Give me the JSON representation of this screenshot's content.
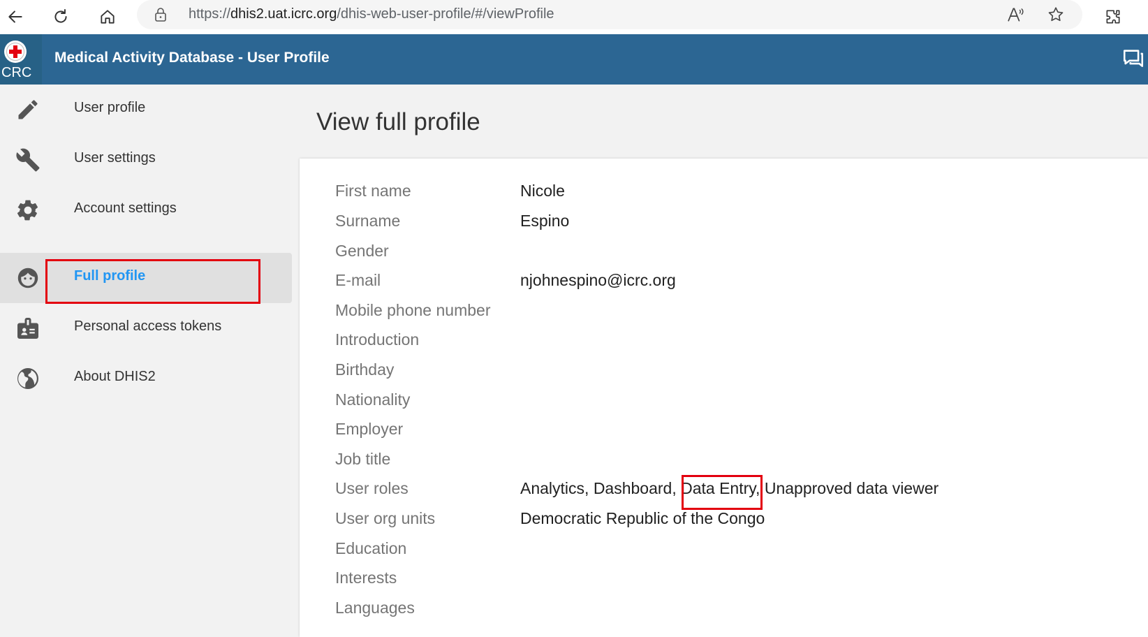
{
  "browser": {
    "url_prefix": "https://",
    "url_host": "dhis2.uat.icrc.org",
    "url_path": "/dhis-web-user-profile/#/viewProfile"
  },
  "header": {
    "logo_text": "CRC",
    "title": "Medical Activity Database - User Profile"
  },
  "sidebar": {
    "items": [
      {
        "label": "User profile",
        "icon": "pencil-icon"
      },
      {
        "label": "User settings",
        "icon": "wrench-icon"
      },
      {
        "label": "Account settings",
        "icon": "gear-icon"
      },
      {
        "label": "Full profile",
        "icon": "face-icon",
        "active": true
      },
      {
        "label": "Personal access tokens",
        "icon": "badge-icon"
      },
      {
        "label": "About DHIS2",
        "icon": "globe-icon"
      }
    ]
  },
  "main": {
    "title": "View full profile",
    "fields": [
      {
        "label": "First name",
        "value": "Nicole"
      },
      {
        "label": "Surname",
        "value": "Espino"
      },
      {
        "label": "Gender",
        "value": ""
      },
      {
        "label": "E-mail",
        "value": "njohnespino@icrc.org"
      },
      {
        "label": "Mobile phone number",
        "value": ""
      },
      {
        "label": "Introduction",
        "value": ""
      },
      {
        "label": "Birthday",
        "value": ""
      },
      {
        "label": "Nationality",
        "value": ""
      },
      {
        "label": "Employer",
        "value": ""
      },
      {
        "label": "Job title",
        "value": ""
      },
      {
        "label": "User roles",
        "value": "Analytics, Dashboard, Data Entry, Unapproved data viewer"
      },
      {
        "label": "User org units",
        "value": "Democratic Republic of the Congo"
      },
      {
        "label": "Education",
        "value": ""
      },
      {
        "label": "Interests",
        "value": ""
      },
      {
        "label": "Languages",
        "value": ""
      }
    ]
  },
  "colors": {
    "header_bg": "#2c6693",
    "active_link": "#2196f3",
    "highlight_box": "#e3000f"
  }
}
